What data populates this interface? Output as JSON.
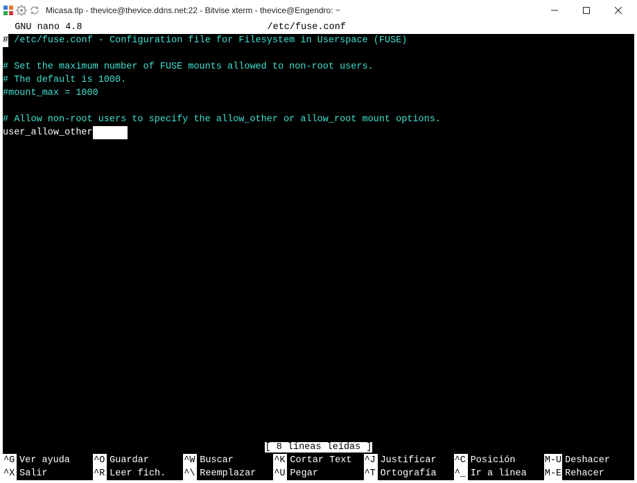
{
  "window": {
    "title": "Micasa.tlp - thevice@thevice.ddns.net:22 - Bitvise xterm - thevice@Engendro: ~"
  },
  "nano": {
    "app": "  GNU nano 4.8",
    "filename": "/etc/fuse.conf"
  },
  "file": {
    "line1": " /etc/fuse.conf - Configuration file for Filesystem in Userspace (FUSE)",
    "blank1": "",
    "line3": "# Set the maximum number of FUSE mounts allowed to non-root users.",
    "line4": "# The default is 1000.",
    "line5": "#mount_max = 1000",
    "blank2": "",
    "line7": "# Allow non-root users to specify the allow_other or allow_root mount options.",
    "line8": "user_allow_other"
  },
  "status": "[ 8 líneas leídas ]",
  "shortcuts": {
    "r1": [
      {
        "k": "^G",
        "l": "Ver ayuda"
      },
      {
        "k": "^O",
        "l": "Guardar"
      },
      {
        "k": "^W",
        "l": "Buscar"
      },
      {
        "k": "^K",
        "l": "Cortar Text"
      },
      {
        "k": "^J",
        "l": "Justificar"
      },
      {
        "k": "^C",
        "l": "Posición"
      }
    ],
    "r1b": {
      "k": "M-U",
      "l": "Deshacer"
    },
    "r2": [
      {
        "k": "^X",
        "l": "Salir"
      },
      {
        "k": "^R",
        "l": "Leer fich."
      },
      {
        "k": "^\\",
        "l": "Reemplazar"
      },
      {
        "k": "^U",
        "l": "Pegar"
      },
      {
        "k": "^T",
        "l": "Ortografía"
      },
      {
        "k": "^_",
        "l": "Ir a línea"
      }
    ],
    "r2b": {
      "k": "M-E",
      "l": "Rehacer"
    }
  },
  "colors": {
    "term_bg": "#000000",
    "term_cyan": "#40e0d0",
    "inv_bg": "#ffffff",
    "inv_fg": "#000000"
  }
}
